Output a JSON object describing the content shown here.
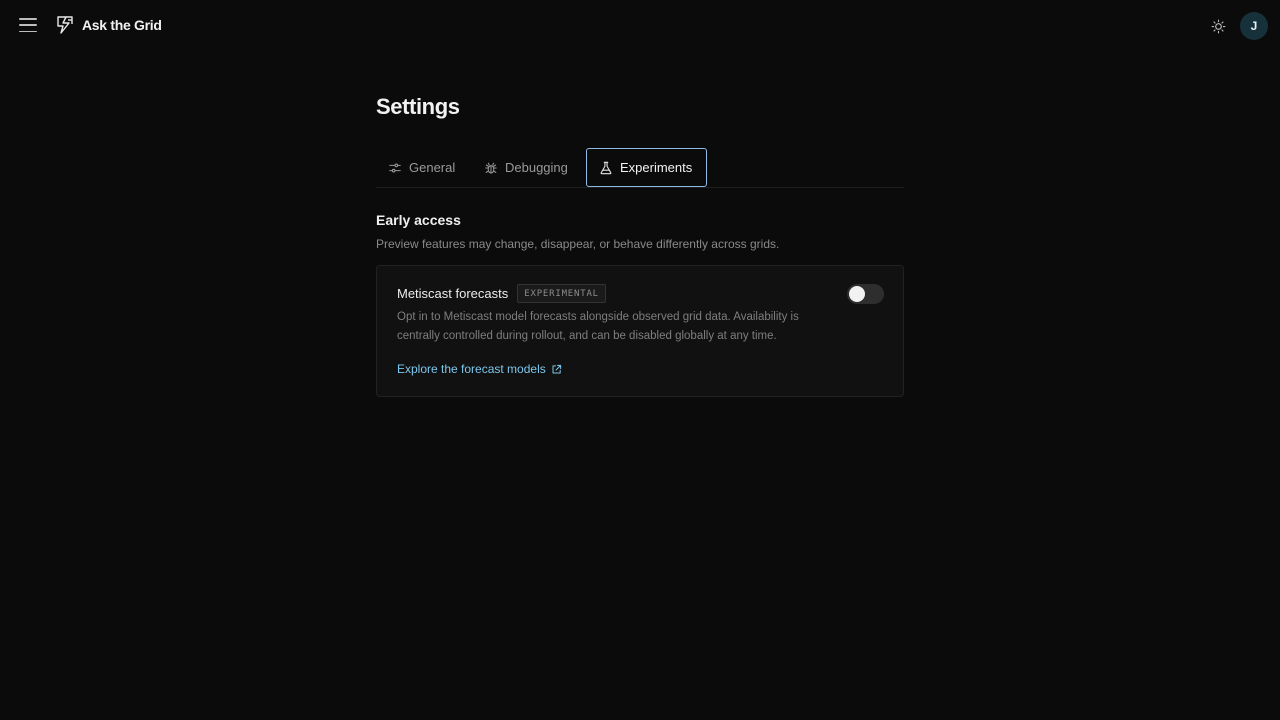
{
  "app": {
    "name": "Ask the Grid",
    "user_initial": "J"
  },
  "icons": {
    "menu": "menu-icon",
    "logo": "grid-logo-icon",
    "theme": "sun-icon",
    "general_tab": "sliders-icon",
    "debugging_tab": "bug-icon",
    "experiments_tab": "flask-icon",
    "link": "external-link-icon"
  },
  "colors": {
    "background": "#0b0b0b",
    "accent_link": "#7cc7ec",
    "active_tab_border": "#8fb9e8",
    "avatar_bg": "#17313a"
  },
  "page": {
    "title": "Settings"
  },
  "tabs": [
    {
      "label": "General",
      "active": false
    },
    {
      "label": "Debugging",
      "active": false
    },
    {
      "label": "Experiments",
      "active": true
    }
  ],
  "section": {
    "title": "Early access",
    "description": "Preview features may change, disappear, or behave differently across grids."
  },
  "feature": {
    "title": "Metiscast forecasts",
    "badge": "EXPERIMENTAL",
    "description": "Opt in to Metiscast model forecasts alongside observed grid data. Availability is centrally controlled during rollout, and can be disabled globally at any time.",
    "enabled": false,
    "link_label": "Explore the forecast models"
  }
}
